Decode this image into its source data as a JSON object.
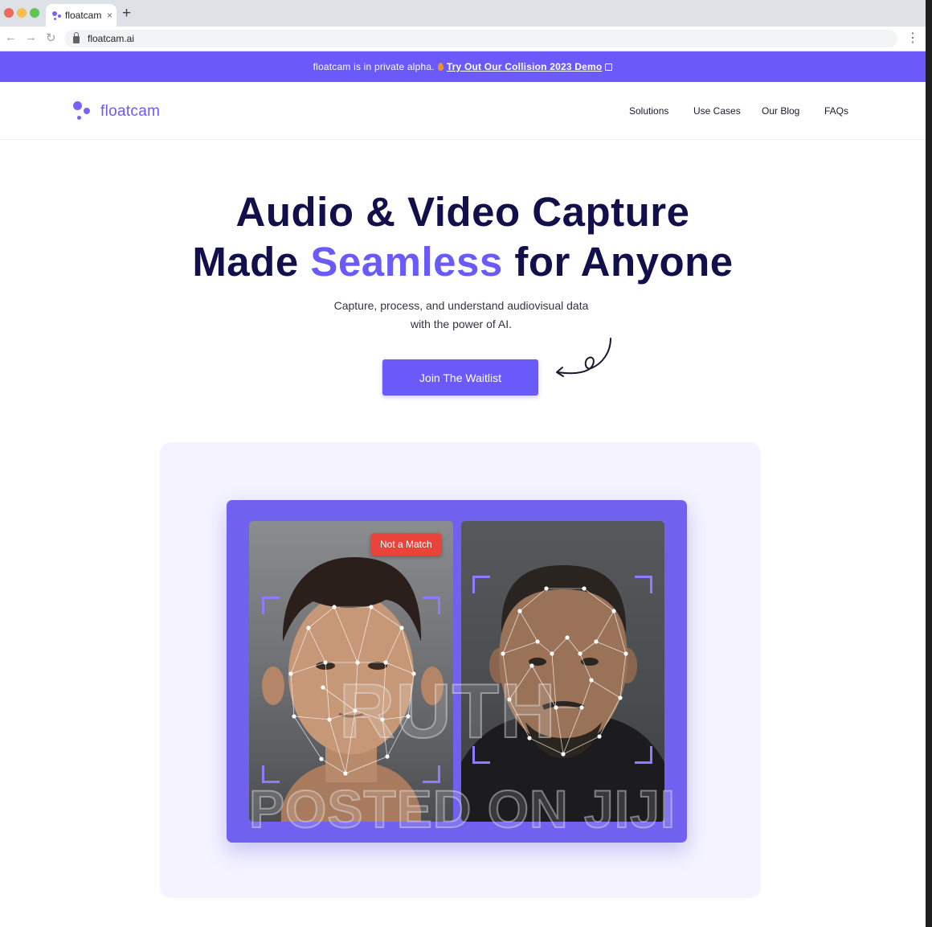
{
  "browser": {
    "tab_title": "floatcam",
    "tab_close": "×",
    "new_tab": "+",
    "url": "floatcam.ai",
    "back": "←",
    "forward": "→",
    "reload": "↻",
    "menu": "⋮"
  },
  "announcement": {
    "text": "floatcam is in private alpha.",
    "link_text": "Try Out Our Collision 2023 Demo",
    "icons": [
      "fire-icon",
      "external-link-icon"
    ]
  },
  "header": {
    "logo_text": "floatcam",
    "nav": [
      {
        "label": "Solutions"
      },
      {
        "label": "Use Cases"
      },
      {
        "label": "Our Blog"
      },
      {
        "label": "FAQs"
      }
    ]
  },
  "hero": {
    "title_line1": "Audio & Video Capture",
    "title_line2_pre": "Made ",
    "title_line2_accent": "Seamless",
    "title_line2_post": " for Anyone",
    "subtitle_line1": "Capture, process, and understand audiovisual data",
    "subtitle_line2": "with the power of AI.",
    "cta_label": "Join The Waitlist"
  },
  "showcase": {
    "badge": "Not a Match"
  },
  "watermark": {
    "line1": "RUTH",
    "line2": "POSTED ON JIJI"
  },
  "colors": {
    "brand": "#6a5af9",
    "title": "#12104a",
    "badge": "#e8443a"
  }
}
